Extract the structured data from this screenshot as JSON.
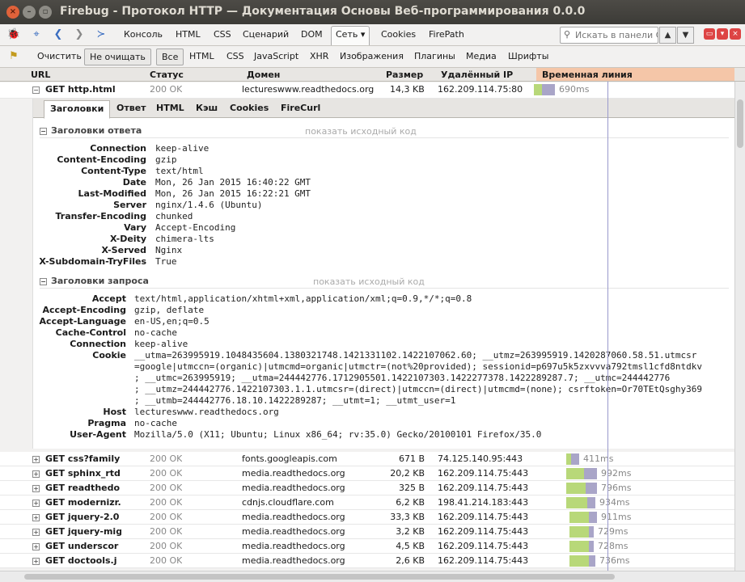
{
  "window": {
    "title": "Firebug - Протокол HTTP — Документация Основы Веб-программирования 0.0.0"
  },
  "panels": [
    "Консоль",
    "HTML",
    "CSS",
    "Сценарий",
    "DOM",
    "Сеть",
    "Cookies",
    "FirePath"
  ],
  "search_placeholder": "Искать в панели С",
  "filters": {
    "clear": "Очистить",
    "persist": "Не очищать",
    "types": [
      "Все",
      "HTML",
      "CSS",
      "JavaScript",
      "XHR",
      "Изображения",
      "Плагины",
      "Медиа",
      "Шрифты"
    ]
  },
  "columns": {
    "url": "URL",
    "status": "Статус",
    "domain": "Домен",
    "size": "Размер",
    "ip": "Удалённый IP",
    "timeline": "Временная линия"
  },
  "main_request": {
    "url": "GET http.html",
    "status": "200 OK",
    "domain": "lectureswww.readthedocs.org",
    "size": "14,3 KB",
    "ip": "162.209.114.75:80",
    "time": "690ms"
  },
  "detail_tabs": [
    "Заголовки",
    "Ответ",
    "HTML",
    "Кэш",
    "Cookies",
    "FireCurl"
  ],
  "response_headers": {
    "title": "Заголовки ответа",
    "raw": "показать исходный код",
    "items": [
      {
        "k": "Connection",
        "v": "keep-alive"
      },
      {
        "k": "Content-Encoding",
        "v": "gzip"
      },
      {
        "k": "Content-Type",
        "v": "text/html"
      },
      {
        "k": "Date",
        "v": "Mon, 26 Jan 2015 16:40:22 GMT"
      },
      {
        "k": "Last-Modified",
        "v": "Mon, 26 Jan 2015 16:22:21 GMT"
      },
      {
        "k": "Server",
        "v": "nginx/1.4.6 (Ubuntu)"
      },
      {
        "k": "Transfer-Encoding",
        "v": "chunked"
      },
      {
        "k": "Vary",
        "v": "Accept-Encoding"
      },
      {
        "k": "X-Deity",
        "v": "chimera-lts"
      },
      {
        "k": "X-Served",
        "v": "Nginx"
      },
      {
        "k": "X-Subdomain-TryFiles",
        "v": "True"
      }
    ]
  },
  "request_headers": {
    "title": "Заголовки запроса",
    "raw": "показать исходный код",
    "items": [
      {
        "k": "Accept",
        "v": "text/html,application/xhtml+xml,application/xml;q=0.9,*/*;q=0.8"
      },
      {
        "k": "Accept-Encoding",
        "v": "gzip, deflate"
      },
      {
        "k": "Accept-Language",
        "v": "en-US,en;q=0.5"
      },
      {
        "k": "Cache-Control",
        "v": "no-cache"
      },
      {
        "k": "Connection",
        "v": "keep-alive"
      },
      {
        "k": "Cookie",
        "v": "__utma=263995919.1048435604.1380321748.1421331102.1422107062.60; __utmz=263995919.1420287060.58.51.utmcsr\n=google|utmccn=(organic)|utmcmd=organic|utmctr=(not%20provided); sessionid=p697u5k5zxvvva792tmsl1cfd8ntdkv\n; __utmc=263995919; __utma=244442776.1712905501.1422107303.1422277378.1422289287.7; __utmc=244442776\n; __utmz=244442776.1422107303.1.1.utmcsr=(direct)|utmccn=(direct)|utmcmd=(none); csrftoken=Or70TEtQsghy369\n; __utmb=244442776.18.10.1422289287; __utmt=1; __utmt_user=1"
      },
      {
        "k": "Host",
        "v": "lectureswww.readthedocs.org"
      },
      {
        "k": "Pragma",
        "v": "no-cache"
      },
      {
        "k": "User-Agent",
        "v": "Mozilla/5.0 (X11; Ubuntu; Linux x86_64; rv:35.0) Gecko/20100101 Firefox/35.0"
      }
    ]
  },
  "requests": [
    {
      "url": "GET css?family",
      "status": "200 OK",
      "domain": "fonts.googleapis.com",
      "size": "671 B",
      "ip": "74.125.140.95:443",
      "time": "411ms"
    },
    {
      "url": "GET sphinx_rtd",
      "status": "200 OK",
      "domain": "media.readthedocs.org",
      "size": "20,2 KB",
      "ip": "162.209.114.75:443",
      "time": "992ms"
    },
    {
      "url": "GET readthedo",
      "status": "200 OK",
      "domain": "media.readthedocs.org",
      "size": "325 B",
      "ip": "162.209.114.75:443",
      "time": "796ms"
    },
    {
      "url": "GET modernizr.",
      "status": "200 OK",
      "domain": "cdnjs.cloudflare.com",
      "size": "6,2 KB",
      "ip": "198.41.214.183:443",
      "time": "934ms"
    },
    {
      "url": "GET jquery-2.0",
      "status": "200 OK",
      "domain": "media.readthedocs.org",
      "size": "33,3 KB",
      "ip": "162.209.114.75:443",
      "time": "911ms"
    },
    {
      "url": "GET jquery-mig",
      "status": "200 OK",
      "domain": "media.readthedocs.org",
      "size": "3,2 KB",
      "ip": "162.209.114.75:443",
      "time": "729ms"
    },
    {
      "url": "GET underscor",
      "status": "200 OK",
      "domain": "media.readthedocs.org",
      "size": "4,5 KB",
      "ip": "162.209.114.75:443",
      "time": "728ms"
    },
    {
      "url": "GET doctools.j",
      "status": "200 OK",
      "domain": "media.readthedocs.org",
      "size": "2,6 KB",
      "ip": "162.209.114.75:443",
      "time": "736ms"
    }
  ]
}
